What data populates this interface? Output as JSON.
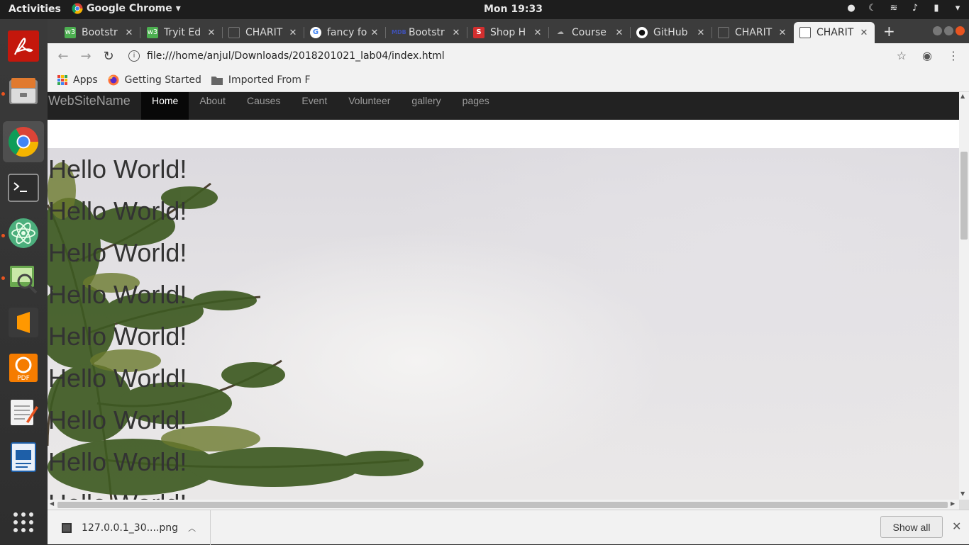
{
  "topbar": {
    "activities": "Activities",
    "app_name": "Google Chrome",
    "clock": "Mon 19:33"
  },
  "dock": {
    "apps": [
      "adobe-reader",
      "file-manager",
      "google-chrome",
      "terminal",
      "atom",
      "image-viewer",
      "sublime-text",
      "pdf-editor",
      "text-editor",
      "document-writer",
      "show-applications"
    ]
  },
  "tabs": [
    {
      "title": "Bootstr",
      "icon": "w3-icon",
      "color": "#4caf50"
    },
    {
      "title": "Tryit Ed",
      "icon": "w3-icon",
      "color": "#4caf50"
    },
    {
      "title": "CHARIT",
      "icon": "page-icon",
      "color": "#666666"
    },
    {
      "title": "fancy fo",
      "icon": "google-icon",
      "color": "#4285f4"
    },
    {
      "title": "Bootstr",
      "icon": "mdb-icon",
      "color": "#3f51b5"
    },
    {
      "title": "Shop H",
      "icon": "shop-icon",
      "color": "#d32f2f"
    },
    {
      "title": "Course",
      "icon": "cloud-icon",
      "color": "#888888"
    },
    {
      "title": "GitHub",
      "icon": "github-icon",
      "color": "#111111"
    },
    {
      "title": "CHARIT",
      "icon": "page-icon",
      "color": "#666666"
    },
    {
      "title": "CHARIT",
      "icon": "page-icon",
      "color": "#666666"
    }
  ],
  "toolbar": {
    "url": "file:///home/anjul/Downloads/2018201021_lab04/index.html"
  },
  "bookmarks": {
    "apps": "Apps",
    "getting_started": "Getting Started",
    "imported": "Imported From F"
  },
  "site": {
    "brand": "WebSiteName",
    "nav": [
      "Home",
      "About",
      "Causes",
      "Event",
      "Volunteer",
      "gallery",
      "pages"
    ],
    "active_nav": "Home",
    "hellos": [
      "Hello World!",
      "Hello World!",
      "Hello World!",
      "Hello World!",
      "Hello World!",
      "Hello World!",
      "Hello World!",
      "Hello World!",
      "Hello World!"
    ]
  },
  "downloads": {
    "file": "127.0.0.1_30....png",
    "show_all": "Show all"
  }
}
